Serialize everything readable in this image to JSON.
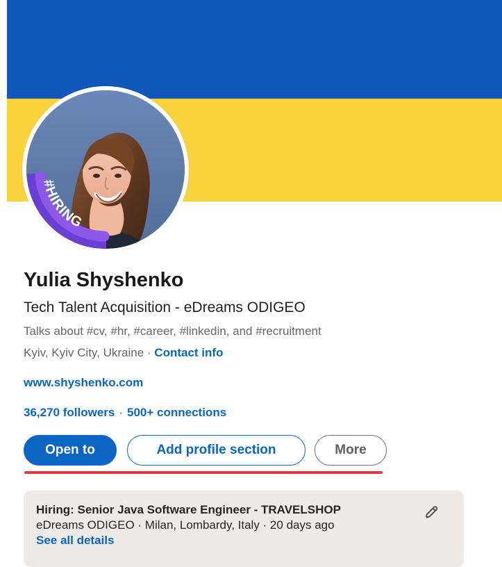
{
  "banner": {
    "flag_top_color": "#0f57b8",
    "flag_bottom_color": "#fad23c"
  },
  "profile": {
    "name": "Yulia Shyshenko",
    "headline": "Tech Talent Acquisition - eDreams ODIGEO",
    "topics": "Talks about #cv, #hr, #career, #linkedin, and #recruitment",
    "location": "Kyiv, Kyiv City, Ukraine",
    "location_separator": " · ",
    "contact_info": "Contact info",
    "website": "www.shyshenko.com",
    "followers": "36,270 followers",
    "network_separator": "·",
    "connections": "500+ connections",
    "hiring_frame_text": "#HIRING",
    "hiring_frame_color": "#6b3fd6"
  },
  "actions": {
    "open_to_label": "Open to",
    "add_profile_section_label": "Add profile section",
    "more_label": "More",
    "underline_color": "#d93c3c"
  },
  "hiring_card": {
    "title": "Hiring: Senior Java Software Engineer - TRAVELSHOP",
    "meta": "eDreams ODIGEO · Milan, Lombardy, Italy · 20 days ago",
    "details_link": "See all details",
    "edit_icon": "pencil-icon"
  },
  "icons": {
    "profile_photo": "profile-photo",
    "edit": "pencil-icon"
  }
}
